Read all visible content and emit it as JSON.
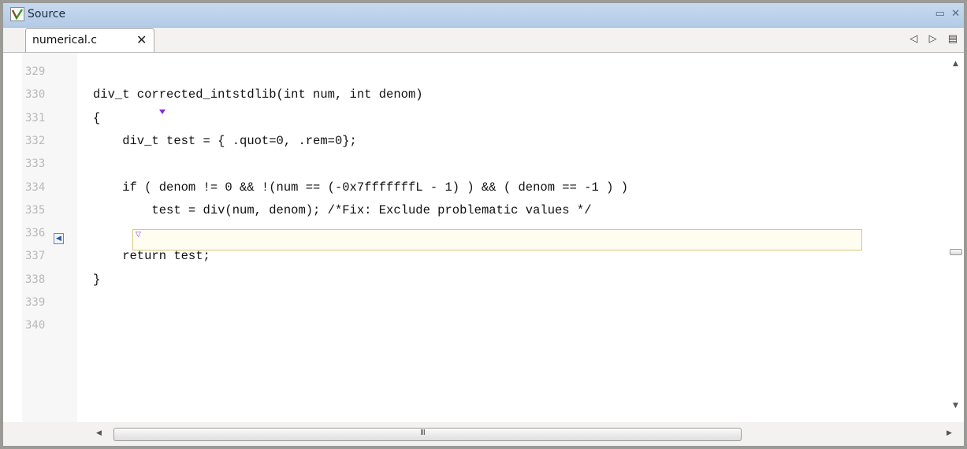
{
  "window": {
    "title": "Source",
    "app_icon": "check-v-icon",
    "buttons": {
      "restore": "▭",
      "close": "✕"
    }
  },
  "tabs": [
    {
      "label": "numerical.c",
      "close": "✕",
      "active": true
    }
  ],
  "tab_tools": {
    "prev": "◁",
    "next": "▷",
    "menu": "▤"
  },
  "editor": {
    "lines": [
      {
        "n": "329",
        "code": ""
      },
      {
        "n": "330",
        "code": "div_t corrected_intstdlib(int num, int denom)"
      },
      {
        "n": "331",
        "code": "{"
      },
      {
        "n": "332",
        "code": "    div_t test = { .quot=0, .rem=0};"
      },
      {
        "n": "333",
        "code": ""
      },
      {
        "n": "334",
        "code": "    if ( denom != 0 && !(num == (-0x7fffffffL - 1) ) && ( denom == -1 ) )"
      },
      {
        "n": "335",
        "code": "        test = div(num, denom); /*Fix: Exclude problematic values */"
      },
      {
        "n": "336",
        "code": ""
      },
      {
        "n": "337",
        "code": "    return test;"
      },
      {
        "n": "338",
        "code": "}"
      },
      {
        "n": "339",
        "code": ""
      },
      {
        "n": "340",
        "code": ""
      }
    ],
    "highlight_color": "#d6c67a",
    "marker_color": "#8a2be2"
  },
  "scrollbars": {
    "h_grip": "III"
  }
}
